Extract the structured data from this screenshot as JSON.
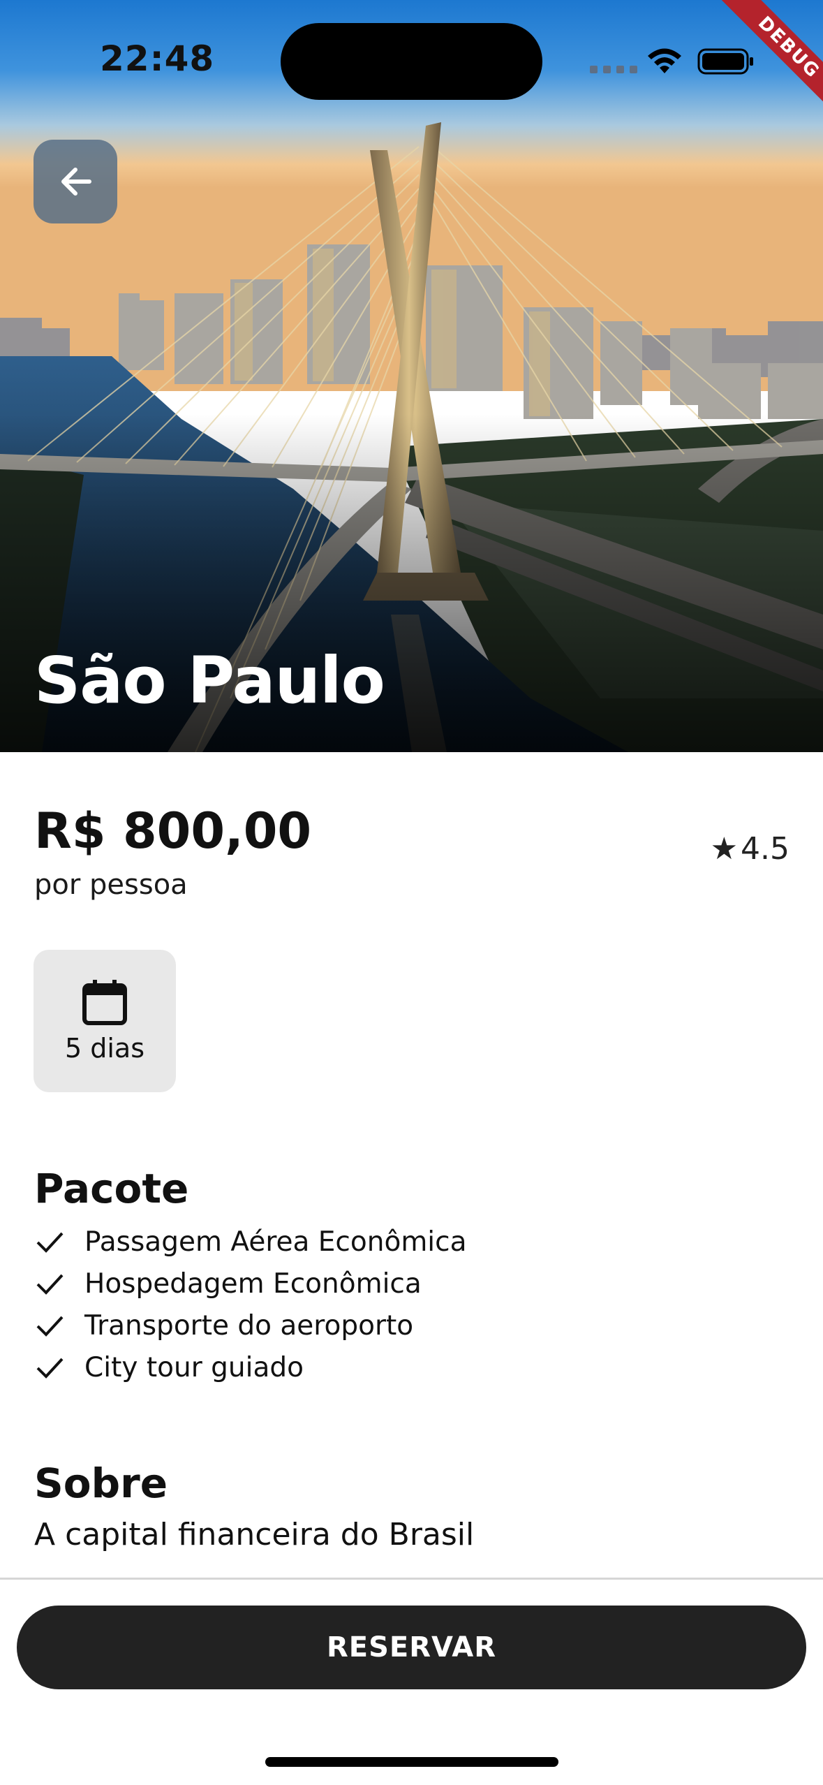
{
  "status_bar": {
    "time": "22:48",
    "debug_label": "DEBUG"
  },
  "destination": {
    "title": "São Paulo",
    "price": "R$ 800,00",
    "price_unit": "por pessoa",
    "rating": "4.5",
    "duration": "5 dias"
  },
  "package": {
    "title": "Pacote",
    "items": [
      "Passagem Aérea Econômica",
      "Hospedagem Econômica",
      "Transporte do aeroporto",
      "City tour guiado"
    ]
  },
  "about": {
    "title": "Sobre",
    "text": "A capital financeira do Brasil"
  },
  "actions": {
    "reserve_label": "RESERVAR"
  },
  "colors": {
    "primary_button": "#222222",
    "chip_background": "#e8e8e8",
    "sky_top": "#1f7ad0",
    "sky_bottom": "#f0c48a"
  },
  "icons": {
    "back": "arrow-left-icon",
    "rating": "star-icon",
    "duration": "calendar-icon",
    "package_item": "check-icon"
  }
}
